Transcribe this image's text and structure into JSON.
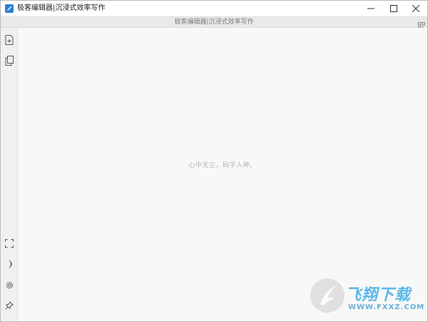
{
  "window": {
    "title": "极客编辑器|沉浸式效率写作",
    "controls": [
      "minimize-icon",
      "maximize-icon",
      "close-icon"
    ]
  },
  "document": {
    "title": "极客编辑器|沉浸式效率写作"
  },
  "toolbar_icons": [
    "qr-code-icon"
  ],
  "sidebar": {
    "top_icons": [
      "new-file-icon",
      "copy-file-icon"
    ],
    "bottom_icons": [
      "fullscreen-icon",
      "dark-mode-icon",
      "settings-icon",
      "pin-icon"
    ]
  },
  "editor": {
    "placeholder": "心中无尘，码字入神。"
  },
  "watermark": {
    "brand": "飞翔下载",
    "url": "WWW.FXXZ.COM"
  },
  "colors": {
    "accent": "#2f7fd1",
    "editor_background": "#f8f8f8",
    "sidebar_background": "#f0f0f0",
    "watermark": "#4ab3e8"
  }
}
